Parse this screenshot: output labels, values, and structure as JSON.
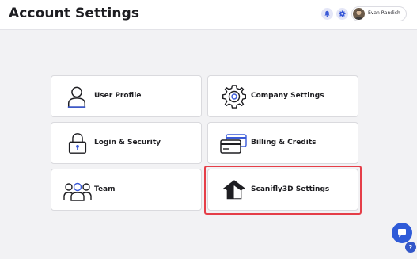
{
  "header": {
    "title": "Account Settings",
    "notification_icon": "bell-icon",
    "settings_icon": "gear-icon",
    "user": {
      "name": "Evan Randich"
    }
  },
  "cards": [
    {
      "label": "User Profile",
      "icon": "user-icon"
    },
    {
      "label": "Company Settings",
      "icon": "gear-icon"
    },
    {
      "label": "Login & Security",
      "icon": "lock-icon"
    },
    {
      "label": "Billing & Credits",
      "icon": "credit-cards-icon"
    },
    {
      "label": "Team",
      "icon": "team-icon"
    },
    {
      "label": "Scanifly3D Settings",
      "icon": "house-icon"
    }
  ],
  "widgets": {
    "chat_icon": "chat-icon",
    "help_label": "?"
  },
  "colors": {
    "accent": "#2f5bd8",
    "highlight": "#e53e48",
    "background": "#f2f2f4"
  }
}
